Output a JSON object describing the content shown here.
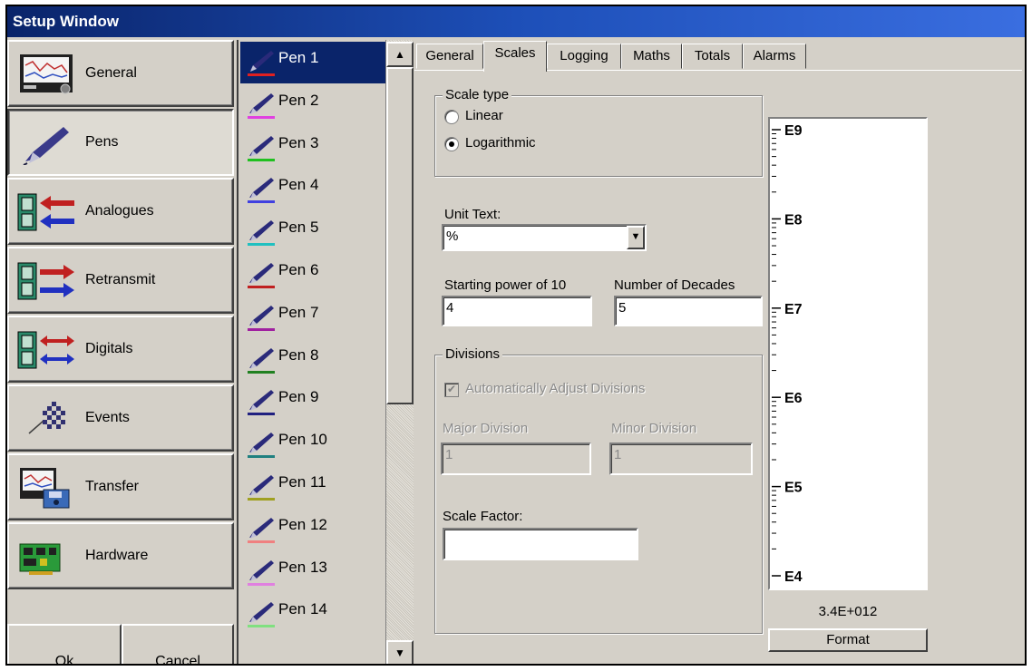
{
  "window": {
    "title": "Setup Window"
  },
  "nav": {
    "items": [
      {
        "label": "General",
        "icon": "recorder-screen-icon"
      },
      {
        "label": "Pens",
        "icon": "pen-icon"
      },
      {
        "label": "Analogues",
        "icon": "analogue-in-icon"
      },
      {
        "label": "Retransmit",
        "icon": "retransmit-icon"
      },
      {
        "label": "Digitals",
        "icon": "digital-io-icon"
      },
      {
        "label": "Events",
        "icon": "events-icon"
      },
      {
        "label": "Transfer",
        "icon": "transfer-icon"
      },
      {
        "label": "Hardware",
        "icon": "hardware-board-icon"
      }
    ],
    "ok_label": "Ok",
    "cancel_label": "Cancel"
  },
  "pens": {
    "items": [
      {
        "label": "Pen 1",
        "color": "#e02020"
      },
      {
        "label": "Pen 2",
        "color": "#e040e0"
      },
      {
        "label": "Pen 3",
        "color": "#20c020"
      },
      {
        "label": "Pen 4",
        "color": "#4040e0"
      },
      {
        "label": "Pen 5",
        "color": "#20c0c0"
      },
      {
        "label": "Pen 6",
        "color": "#c02020"
      },
      {
        "label": "Pen 7",
        "color": "#a020a0"
      },
      {
        "label": "Pen 8",
        "color": "#208020"
      },
      {
        "label": "Pen 9",
        "color": "#202080"
      },
      {
        "label": "Pen 10",
        "color": "#208080"
      },
      {
        "label": "Pen 11",
        "color": "#a0a020"
      },
      {
        "label": "Pen 12",
        "color": "#f08080"
      },
      {
        "label": "Pen 13",
        "color": "#e080e0"
      },
      {
        "label": "Pen 14",
        "color": "#80e080"
      }
    ],
    "selected": "Pen 1"
  },
  "tabs": [
    "General",
    "Scales",
    "Logging",
    "Maths",
    "Totals",
    "Alarms"
  ],
  "active_tab": "Scales",
  "scales": {
    "scale_type_title": "Scale type",
    "linear_label": "Linear",
    "log_label": "Logarithmic",
    "selected_type": "Logarithmic",
    "unit_text_label": "Unit Text:",
    "unit_text_value": "%",
    "start_power_label": "Starting power of 10",
    "start_power_value": "4",
    "decades_label": "Number of Decades",
    "decades_value": "5",
    "divisions_title": "Divisions",
    "auto_adjust_label": "Automatically Adjust Divisions",
    "auto_adjust_checked": true,
    "major_label": "Major Division",
    "major_value": "1",
    "minor_label": "Minor Division",
    "minor_value": "1",
    "scale_factor_label": "Scale Factor:",
    "scale_factor_value": ""
  },
  "preview": {
    "labels": [
      "E9",
      "E8",
      "E7",
      "E6",
      "E5",
      "E4"
    ],
    "max_value": "3.4E+012",
    "format_label": "Format"
  }
}
